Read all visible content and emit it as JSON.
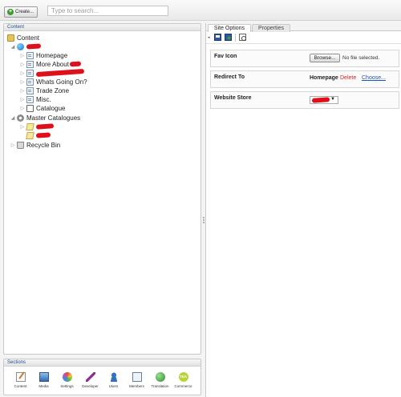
{
  "toolbar": {
    "create_label": "Create...",
    "search_placeholder": "Type to search..."
  },
  "content_panel": {
    "title": "Content",
    "tree": {
      "root": "Content",
      "site_children": [
        "Homepage",
        "More About",
        "",
        "Whats Going On?",
        "Trade Zone",
        "Misc.",
        "Catalogue"
      ],
      "master_catalogues": "Master Catalogues",
      "recycle_bin": "Recycle Bin"
    }
  },
  "sections_panel": {
    "title": "Sections",
    "items": [
      "Content",
      "Media",
      "Settings",
      "Developer",
      "Users",
      "Members",
      "Translation",
      "Commerce"
    ],
    "commerce_badge": "TEA"
  },
  "editor": {
    "tabs": [
      "Site Options",
      "Properties"
    ],
    "properties": {
      "fav_icon_label": "Fav Icon",
      "browse_label": "Browse...",
      "file_status": "No file selected.",
      "redirect_label": "Redirect To",
      "redirect_value": "Homepage",
      "delete_label": "Delete",
      "choose_label": "Choose...",
      "store_label": "Website Store"
    }
  },
  "colors": {
    "accent_blue": "#1f4f8f",
    "link_blue": "#1c55b3",
    "delete_red": "#d42020",
    "redaction_red": "#e0101a"
  }
}
